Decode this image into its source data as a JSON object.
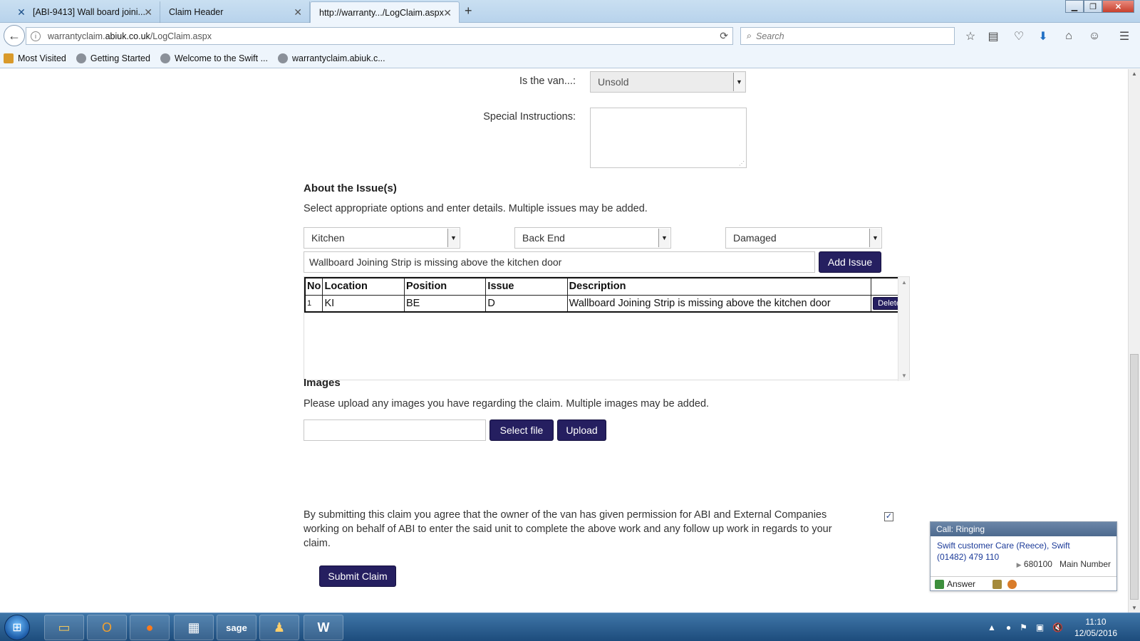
{
  "browser": {
    "tabs": [
      {
        "label": "[ABI-9413] Wall board joini...",
        "icon": "jira-icon"
      },
      {
        "label": "Claim Header",
        "icon": ""
      },
      {
        "label": "http://warranty.../LogClaim.aspx",
        "icon": ""
      }
    ],
    "url_prefix": "warrantyclaim.",
    "url_domain": "abiuk.co.uk",
    "url_path": "/LogClaim.aspx",
    "search_placeholder": "Search",
    "bookmarks": [
      "Most Visited",
      "Getting Started",
      "Welcome to the Swift ...",
      "warrantyclaim.abiuk.c..."
    ]
  },
  "form": {
    "van_label": "Is the van...:",
    "van_value": "Unsold",
    "special_label": "Special Instructions:",
    "special_value": ""
  },
  "issues_section": {
    "heading": "About the Issue(s)",
    "instructions": "Select appropriate options and enter details. Multiple issues may be added.",
    "location_value": "Kitchen",
    "position_value": "Back End",
    "issue_value": "Damaged",
    "description_value": "Wallboard Joining Strip is missing above the kitchen door",
    "add_label": "Add Issue",
    "columns": [
      "No",
      "Location",
      "Position",
      "Issue",
      "Description",
      ""
    ],
    "rows": [
      {
        "no": "1",
        "location": "KI",
        "position": "BE",
        "issue": "D",
        "description": "Wallboard Joining Strip is missing above the kitchen door",
        "action": "Delete"
      }
    ]
  },
  "images_section": {
    "heading": "Images",
    "instructions": "Please upload any images you have regarding the claim. Multiple images may be added.",
    "file_value": "",
    "select_label": "Select file",
    "upload_label": "Upload"
  },
  "consent": {
    "text": "By submitting this claim you agree that the owner of the van has given permission for ABI and External Companies working on behalf of ABI to enter the said unit to complete the above work and any follow up work in regards to your claim.",
    "checked": true
  },
  "submit_label": "Submit Claim",
  "call_popup": {
    "title": "Call: Ringing",
    "caller_line1": "Swift customer Care (Reece), Swift",
    "caller_line2": "(01482) 479 110",
    "number": "680100",
    "number_label": "Main Number",
    "answer_label": "Answer"
  },
  "taskbar": {
    "apps": [
      "explorer-icon",
      "outlook-icon",
      "firefox-icon",
      "calendar-app-icon",
      "sage-icon",
      "app-icon",
      "word-icon"
    ],
    "time": "11:10",
    "date": "12/05/2016"
  },
  "colors": {
    "button": "#251f60",
    "link": "#1c3b99"
  }
}
